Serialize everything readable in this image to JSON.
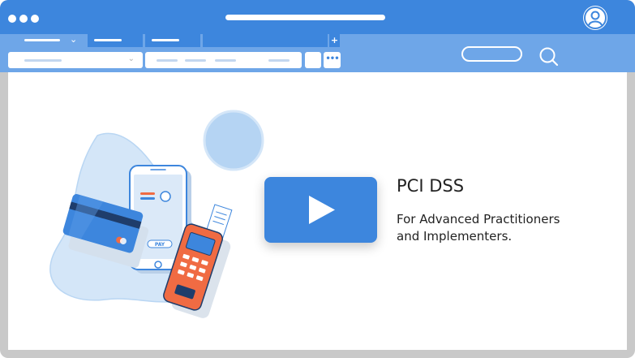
{
  "window": {
    "colors": {
      "titlebar": "#3d86dd",
      "toolbar": "#6ea6e8",
      "frame": "#c9c9c9",
      "accent": "#3d86dd",
      "card_orange": "#f06b43"
    },
    "icons": [
      "window-dots-icon",
      "account-icon",
      "add-tab-icon",
      "more-icon",
      "search-icon",
      "play-icon"
    ]
  },
  "illustration": {
    "pay_label": "PAY"
  },
  "video": {
    "title": "PCI DSS",
    "subtitle_line1": "For Advanced Practitioners",
    "subtitle_line2": "and Implementers."
  }
}
